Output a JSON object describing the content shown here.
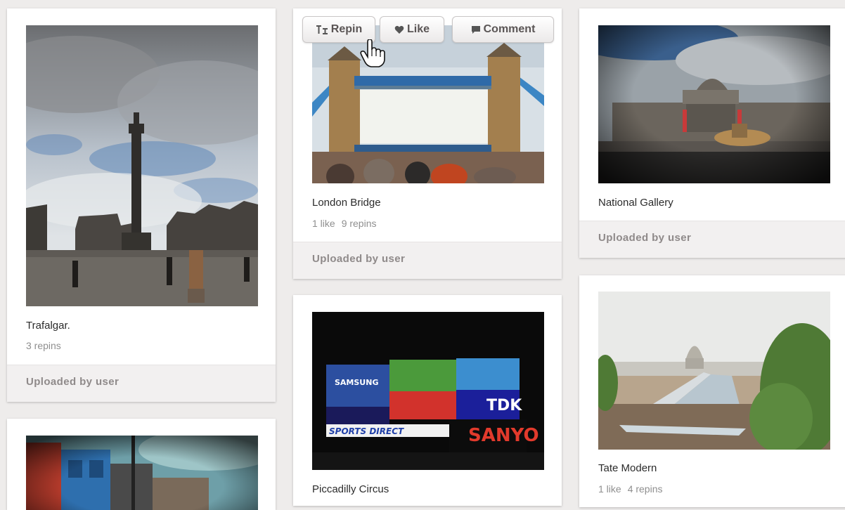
{
  "pins": [
    {
      "id": "trafalgar",
      "title": "Trafalgar.",
      "stats": [
        "3 repins"
      ],
      "footer": "Uploaded by user"
    },
    {
      "id": "london-bridge",
      "title": "London Bridge",
      "stats": [
        "1 like",
        "9 repins"
      ],
      "footer": "Uploaded by user"
    },
    {
      "id": "national-gallery",
      "title": "National Gallery",
      "stats": [],
      "footer": "Uploaded by user"
    },
    {
      "id": "piccadilly",
      "title": "Piccadilly Circus",
      "stats": [],
      "footer": ""
    },
    {
      "id": "tate-modern",
      "title": "Tate Modern",
      "stats": [
        "1 like",
        "4 repins"
      ],
      "footer": ""
    },
    {
      "id": "camden",
      "title": "",
      "stats": [],
      "footer": ""
    }
  ],
  "actions": {
    "repin_label": "Repin",
    "like_label": "Like",
    "comment_label": "Comment",
    "repin_icon": "repin-icon",
    "like_icon": "heart-icon",
    "comment_icon": "comment-icon"
  },
  "signs": {
    "samsung": "SAMSUNG",
    "tdk": "TDK",
    "sanyo": "SANYO",
    "sports": "SPORTS DIRECT"
  },
  "colors": {
    "background": "#eeeceb",
    "card": "#ffffff",
    "footer": "#f2f0f0",
    "footer_text": "#8f8a8a",
    "meta_text": "#8f8f8f"
  }
}
